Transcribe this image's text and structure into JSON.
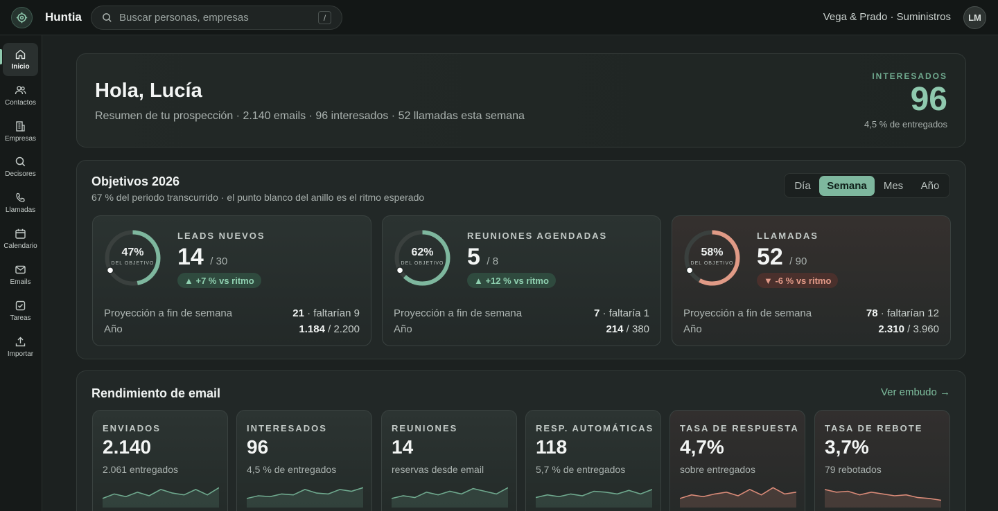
{
  "app": {
    "name": "Huntia",
    "company": "Vega & Prado · Suministros",
    "user_initials": "LM"
  },
  "search": {
    "placeholder": "Buscar personas, empresas",
    "shortcut": "/"
  },
  "sidebar": {
    "items": [
      {
        "label": "Inicio",
        "icon": "home-icon",
        "active": true
      },
      {
        "label": "Contactos",
        "icon": "users-icon"
      },
      {
        "label": "Empresas",
        "icon": "building-icon"
      },
      {
        "label": "Decisores",
        "icon": "search-icon"
      },
      {
        "label": "Llamadas",
        "icon": "phone-icon"
      },
      {
        "label": "Calendario",
        "icon": "calendar-icon"
      },
      {
        "label": "Emails",
        "icon": "mail-icon"
      },
      {
        "label": "Tareas",
        "icon": "checkbox-icon"
      },
      {
        "label": "Importar",
        "icon": "upload-icon"
      }
    ]
  },
  "hero": {
    "greeting": "Hola, Lucía",
    "summary": "Resumen de tu prospección · 2.140 emails · 96 interesados · 52 llamadas esta semana",
    "kpi_label": "INTERESADOS",
    "kpi_value": "96",
    "kpi_caption": "4,5 % de entregados"
  },
  "goals": {
    "title": "Objetivos 2026",
    "subtitle": "67 % del periodo transcurrido · el punto blanco del anillo es el ritmo esperado",
    "periods": [
      "Día",
      "Semana",
      "Mes",
      "Año"
    ],
    "selected_period": "Semana",
    "ring_caption": "DEL OBJETIVO",
    "row_week_label": "Proyección a fin de semana",
    "row_year_label": "Año",
    "cards": [
      {
        "label": "LEADS NUEVOS",
        "value": "14",
        "target": "/ 30",
        "percent": "47%",
        "progress": 0.47,
        "expected": 0.67,
        "color": "#7eb79e",
        "delta": "▲ +7 % vs ritmo",
        "trend": "up",
        "proj_value": "21",
        "proj_note": " · faltarían 9",
        "year_value": "1.184",
        "year_target": " / 2.200"
      },
      {
        "label": "REUNIONES AGENDADAS",
        "value": "5",
        "target": "/ 8",
        "percent": "62%",
        "progress": 0.62,
        "expected": 0.67,
        "color": "#7eb79e",
        "delta": "▲ +12 % vs ritmo",
        "trend": "up",
        "proj_value": "7",
        "proj_note": " · faltaría 1",
        "year_value": "214",
        "year_target": " / 380"
      },
      {
        "label": "LLAMADAS",
        "value": "52",
        "target": "/ 90",
        "percent": "58%",
        "progress": 0.58,
        "expected": 0.67,
        "color": "#e09a86",
        "delta": "▼ -6 % vs ritmo",
        "trend": "down",
        "proj_value": "78",
        "proj_note": " · faltarían 12",
        "year_value": "2.310",
        "year_target": " / 3.960"
      }
    ]
  },
  "email": {
    "title": "Rendimiento de email",
    "link": "Ver embudo →",
    "cards": [
      {
        "label": "ENVIADOS",
        "value": "2.140",
        "caption": "2.061 entregados",
        "color": "#6fa98e"
      },
      {
        "label": "INTERESADOS",
        "value": "96",
        "caption": "4,5 % de entregados",
        "color": "#6fa98e"
      },
      {
        "label": "REUNIONES",
        "value": "14",
        "caption": "reservas desde email",
        "color": "#6fa98e"
      },
      {
        "label": "RESP. AUTOMÁTICAS",
        "value": "118",
        "caption": "5,7 % de entregados",
        "color": "#6fa98e"
      },
      {
        "label": "TASA DE RESPUESTA",
        "value": "4,7%",
        "caption": "sobre entregados",
        "color": "#d98a78"
      },
      {
        "label": "TASA DE REBOTE",
        "value": "3,7%",
        "caption": "79 rebotados",
        "color": "#d98a78"
      }
    ]
  }
}
